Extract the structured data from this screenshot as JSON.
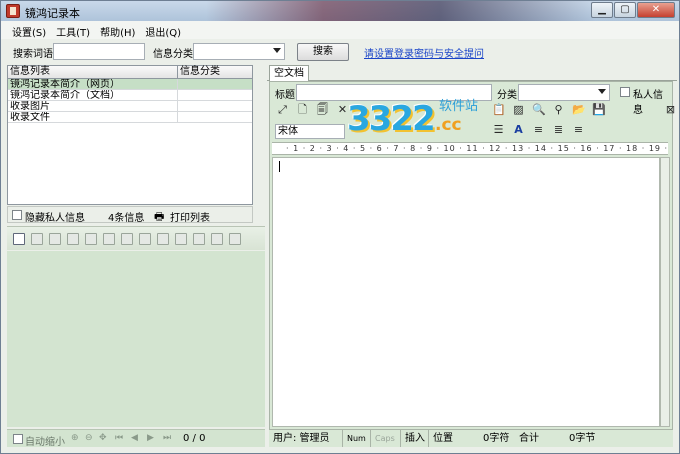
{
  "window": {
    "title": "镜鸿记录本"
  },
  "menu": [
    "设置(S)",
    "工具(T)",
    "帮助(H)",
    "退出(Q)"
  ],
  "search": {
    "keyword_label": "搜索词语",
    "keyword_value": "",
    "category_label": "信息分类",
    "category_value": "",
    "button": "搜索",
    "link": "请设置登录密码与安全提问"
  },
  "list": {
    "headers": [
      "信息列表",
      "信息分类"
    ],
    "rows": [
      {
        "name": "镜鸿记录本简介（网页）",
        "category": ""
      },
      {
        "name": "镜鸿记录本简介（文档）",
        "category": ""
      },
      {
        "name": "收录图片",
        "category": ""
      },
      {
        "name": "收录文件",
        "category": ""
      }
    ],
    "hide_private": "隐藏私人信息",
    "count": "4条信息",
    "print": "打印列表"
  },
  "left_status": {
    "auto_shrink": "自动缩小",
    "page": "0 / 0"
  },
  "document": {
    "tab": "空文档",
    "title_label": "标题",
    "title_value": "",
    "category_label": "分类",
    "category_value": "",
    "private_label": "私人信息",
    "font": "宋体"
  },
  "ruler": "· 1 · 2 · 3 · 4 · 5 · 6 · 7 · 8 · 9 · 10 · 11 · 12 · 13 · 14 · 15 · 16 · 17 · 18 · 19 ·",
  "status": {
    "user": "用户: 管理员",
    "num": "Num",
    "caps": "Caps",
    "insert": "插入",
    "position": "位置",
    "chars": "0字符",
    "total": "合计",
    "bytes": "0字节"
  },
  "watermark": {
    "number": "3322",
    "cc": ".cc",
    "cn": "软件站"
  }
}
